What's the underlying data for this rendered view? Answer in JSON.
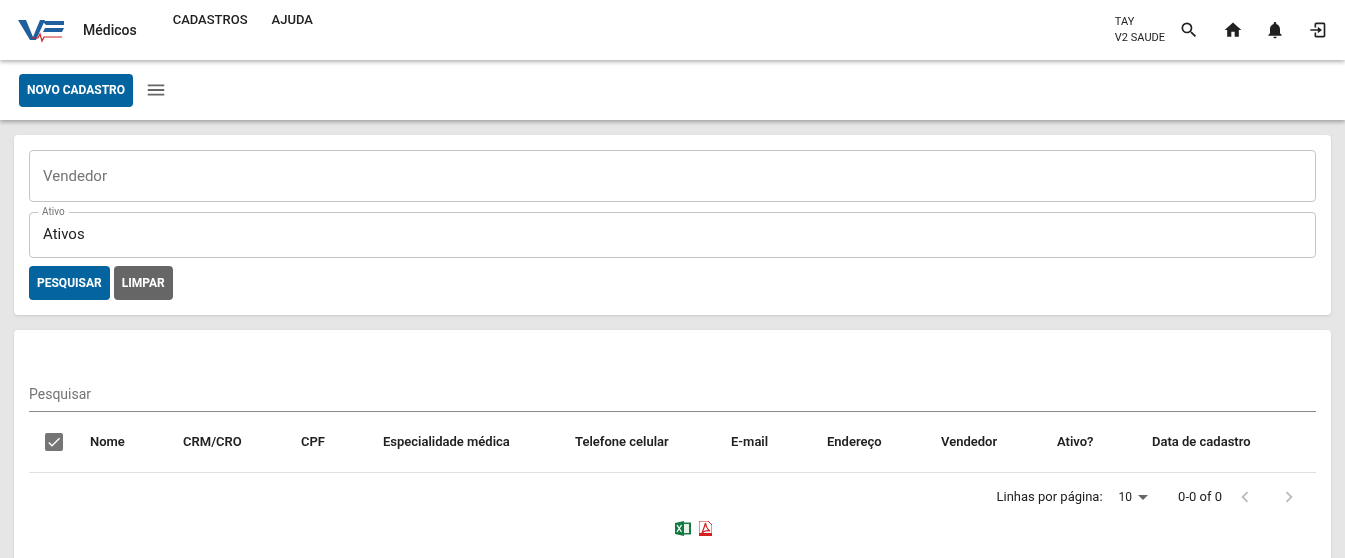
{
  "app_bar": {
    "title": "Médicos",
    "menu": [
      {
        "label": "CADASTROS"
      },
      {
        "label": "AJUDA"
      }
    ],
    "user": {
      "name": "TAY",
      "company": "V2 SAUDE"
    }
  },
  "toolbar": {
    "new_button": "NOVO CADASTRO"
  },
  "filters": {
    "fields": [
      {
        "label": "Vendedor"
      },
      {
        "label": "Ativo",
        "value": "Ativos"
      }
    ],
    "buttons": [
      {
        "label": "PESQUISAR",
        "kind": "primary"
      },
      {
        "label": "LIMPAR",
        "kind": "secondary"
      }
    ]
  },
  "table": {
    "search": {
      "placeholder": "Pesquisar"
    },
    "select_all_checked": true,
    "columns": [
      "Nome",
      "CRM/CRO",
      "CPF",
      "Especialidade médica",
      "Telefone celular",
      "E-mail",
      "Endereço",
      "Vendedor",
      "Ativo?",
      "Data de cadastro"
    ],
    "pagination": {
      "rows_label": "Linhas por página:",
      "rows_per_page": "10",
      "range": "0-0 of 0"
    }
  }
}
